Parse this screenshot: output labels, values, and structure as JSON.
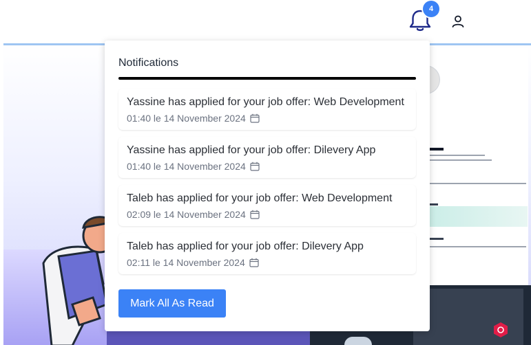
{
  "header": {
    "notification_count": "4",
    "icons": {
      "notifications": "bell-icon",
      "profile": "user-icon"
    }
  },
  "notifications": {
    "title": "Notifications",
    "items": [
      {
        "message": "Yassine has applied for your job offer: Web Development",
        "time": "01:40 le 14 November 2024"
      },
      {
        "message": "Yassine has applied for your job offer: Dilevery App",
        "time": "01:40 le 14 November 2024"
      },
      {
        "message": "Taleb has applied for your job offer: Web Development",
        "time": "02:09 le 14 November 2024"
      },
      {
        "message": "Taleb has applied for your job offer: Dilevery App",
        "time": "02:11 le 14 November 2024"
      }
    ],
    "mark_all_label": "Mark All As Read",
    "item_icon": "calendar-icon"
  },
  "colors": {
    "accent": "#3b82f6",
    "bell_stroke": "#1e2a8a",
    "title_rule": "#000000"
  }
}
